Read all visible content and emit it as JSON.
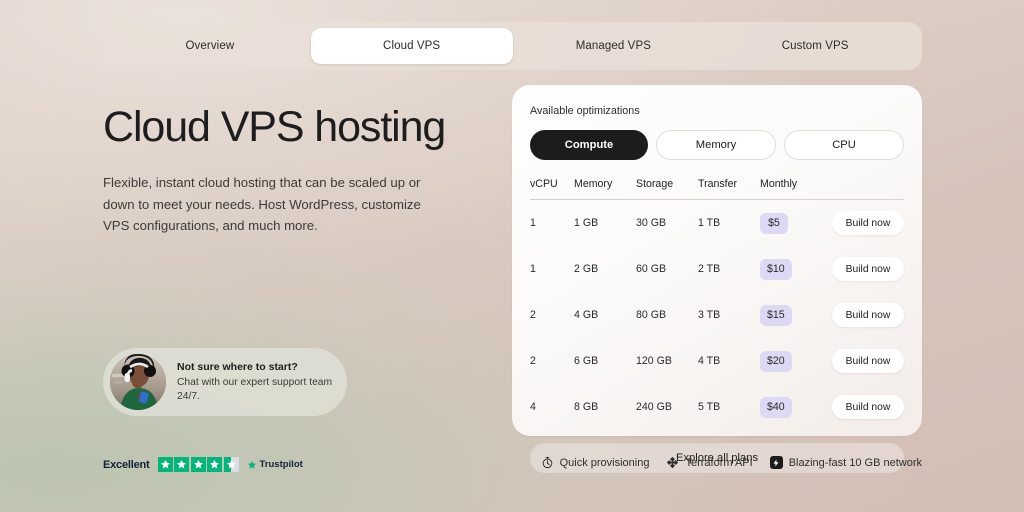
{
  "tabs": [
    {
      "label": "Overview",
      "active": false
    },
    {
      "label": "Cloud VPS",
      "active": true
    },
    {
      "label": "Managed VPS",
      "active": false
    },
    {
      "label": "Custom VPS",
      "active": false
    }
  ],
  "hero": {
    "title": "Cloud VPS hosting",
    "description": "Flexible, instant cloud hosting that can be scaled up or down to meet your needs. Host WordPress, customize VPS configurations, and much more."
  },
  "support": {
    "title": "Not sure where to start?",
    "subtitle": "Chat with our expert support team 24/7.",
    "avatar_alt": "support-agent-photo"
  },
  "trustpilot": {
    "rating_word": "Excellent",
    "brand": "Trustpilot",
    "stars_full": 4,
    "stars_half": 1,
    "star_color": "#00b67a"
  },
  "card": {
    "label": "Available optimizations",
    "optimizations": [
      {
        "label": "Compute",
        "active": true
      },
      {
        "label": "Memory",
        "active": false
      },
      {
        "label": "CPU",
        "active": false
      }
    ],
    "columns": [
      "vCPU",
      "Memory",
      "Storage",
      "Transfer",
      "Monthly"
    ],
    "rows": [
      {
        "vcpu": "1",
        "memory": "1 GB",
        "storage": "30 GB",
        "transfer": "1 TB",
        "monthly": "$5",
        "action": "Build now"
      },
      {
        "vcpu": "1",
        "memory": "2 GB",
        "storage": "60 GB",
        "transfer": "2 TB",
        "monthly": "$10",
        "action": "Build now"
      },
      {
        "vcpu": "2",
        "memory": "4 GB",
        "storage": "80 GB",
        "transfer": "3 TB",
        "monthly": "$15",
        "action": "Build now"
      },
      {
        "vcpu": "2",
        "memory": "6 GB",
        "storage": "120 GB",
        "transfer": "4 TB",
        "monthly": "$20",
        "action": "Build now"
      },
      {
        "vcpu": "4",
        "memory": "8 GB",
        "storage": "240 GB",
        "transfer": "5 TB",
        "monthly": "$40",
        "action": "Build now"
      }
    ],
    "explore_label": "Explore all plans",
    "price_badge_color": "#ddd9f4"
  },
  "features": [
    {
      "icon": "stopwatch-icon",
      "label": "Quick provisioning"
    },
    {
      "icon": "terraform-icon",
      "label": "Terraform API"
    },
    {
      "icon": "lightning-bolt-icon",
      "label": "Blazing-fast 10 GB network"
    }
  ]
}
